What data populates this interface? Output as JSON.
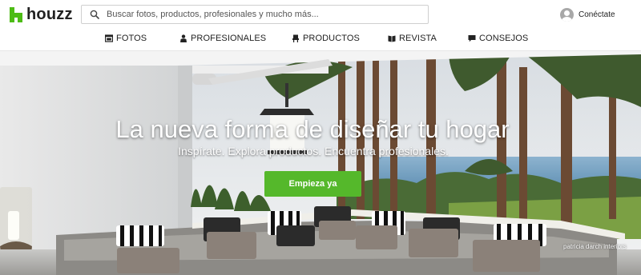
{
  "header": {
    "logo_text": "houzz",
    "search": {
      "placeholder": "Buscar fotos, productos, profesionales y mucho más..."
    },
    "login_label": "Conéctate"
  },
  "nav": {
    "items": [
      {
        "label": "FOTOS",
        "icon": "photo-icon"
      },
      {
        "label": "PROFESIONALES",
        "icon": "professional-icon"
      },
      {
        "label": "PRODUCTOS",
        "icon": "product-icon"
      },
      {
        "label": "REVISTA",
        "icon": "magazine-icon"
      },
      {
        "label": "CONSEJOS",
        "icon": "advice-icon"
      }
    ]
  },
  "hero": {
    "title": "La nueva forma de diseñar tu hogar",
    "subtitle": "Inspírate. Explora productos. Encuentra profesionales.",
    "cta_label": "Empieza ya",
    "credit": "patricia darch interiors"
  },
  "colors": {
    "brand_green": "#4dbc15",
    "cta_green": "#55b82b"
  }
}
